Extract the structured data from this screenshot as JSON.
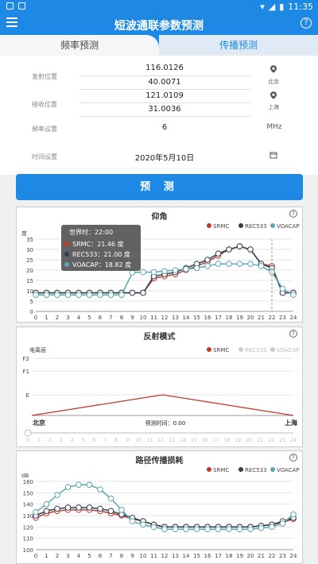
{
  "status": {
    "time": "11:35"
  },
  "app": {
    "title": "短波通联参数预测"
  },
  "tabs": [
    {
      "label": "频率预测"
    },
    {
      "label": "传播预测"
    }
  ],
  "form": {
    "tx": {
      "label": "发射位置",
      "lon": "116.0126",
      "lat": "40.0071",
      "city": "北京"
    },
    "rx": {
      "label": "接收位置",
      "lon": "121.0109",
      "lat": "31.0036",
      "city": "上海"
    },
    "freq": {
      "label": "频率设置",
      "value": "6",
      "unit": "MHz"
    },
    "date": {
      "label": "时间设置",
      "value": "2020年5月10日"
    }
  },
  "predict_button": {
    "label": "预 测"
  },
  "colors": {
    "srmc": "#c0392b",
    "rec533": "#2c3e50",
    "voacap": "#5aa7b0",
    "accent": "#1e88e5"
  },
  "legend": [
    "SRMC",
    "REC533",
    "VOACAP"
  ],
  "chart_data": [
    {
      "type": "line",
      "title": "仰角",
      "ylabel": "度",
      "ylim": [
        0,
        35
      ],
      "yticks": [
        0,
        5,
        10,
        15,
        20,
        25,
        30,
        35
      ],
      "x": [
        0,
        1,
        2,
        3,
        4,
        5,
        6,
        7,
        8,
        9,
        10,
        11,
        12,
        13,
        14,
        15,
        16,
        17,
        18,
        19,
        20,
        21,
        22,
        23,
        24
      ],
      "series": [
        {
          "name": "SRMC",
          "values": [
            9,
            9,
            9,
            9,
            9,
            9,
            9,
            9,
            9,
            9,
            9,
            16,
            17,
            18,
            20,
            22,
            24,
            27,
            30,
            31.5,
            30,
            23,
            22,
            9,
            9
          ]
        },
        {
          "name": "REC533",
          "values": [
            9,
            9,
            9,
            9,
            9,
            9,
            9,
            9,
            9,
            9,
            9,
            17,
            18,
            19,
            21,
            23,
            25,
            28,
            30,
            31.5,
            30,
            23,
            21,
            9,
            9
          ]
        },
        {
          "name": "VOACAP",
          "values": [
            8,
            8,
            8,
            8,
            8,
            8,
            8,
            8,
            8,
            18.8,
            19,
            19,
            19.5,
            20,
            20.5,
            21,
            22,
            23,
            23,
            23,
            23,
            22,
            19,
            11,
            8
          ]
        }
      ],
      "tooltip": {
        "title": "世界时：22:00",
        "items": [
          "SRMC：21.46 度",
          "REC533：21.00 度",
          "VOACAP：18.82 度"
        ]
      }
    },
    {
      "type": "line",
      "title": "反射模式",
      "ylabel": "电离层",
      "ycats": [
        "",
        "E",
        "F1",
        "F2"
      ],
      "x": [
        0,
        1,
        2,
        3,
        4,
        5,
        6,
        7,
        8,
        9,
        10,
        11,
        12,
        13,
        14,
        15,
        16,
        17,
        18,
        19,
        20,
        21,
        22,
        23,
        24
      ],
      "start_label": "北京",
      "end_label": "上海",
      "center_label": "预测时间：0:00"
    },
    {
      "type": "line",
      "title": "路径传播损耗",
      "ylabel": "dB",
      "ylim": [
        100,
        160
      ],
      "yticks": [
        100,
        110,
        120,
        130,
        140,
        150,
        160
      ],
      "x": [
        0,
        1,
        2,
        3,
        4,
        5,
        6,
        7,
        8,
        9,
        10,
        11,
        12,
        13,
        14,
        15,
        16,
        17,
        18,
        19,
        20,
        21,
        22,
        23,
        24
      ],
      "series": [
        {
          "name": "SRMC",
          "values": [
            128,
            132,
            134,
            135,
            135,
            135,
            134,
            132,
            130,
            127,
            125,
            122,
            120,
            120,
            120,
            120,
            120,
            120,
            120,
            120,
            120,
            121,
            122,
            124,
            127
          ]
        },
        {
          "name": "REC533",
          "values": [
            130,
            134,
            136,
            137,
            137,
            137,
            136,
            134,
            131,
            128,
            125,
            122,
            120,
            120,
            120,
            120,
            120,
            120,
            120,
            120,
            120,
            121,
            122,
            125,
            128
          ]
        },
        {
          "name": "VOACAP",
          "values": [
            133,
            140,
            148,
            155,
            157,
            157,
            153,
            145,
            135,
            125,
            122,
            120,
            118,
            118,
            118,
            118,
            118,
            118,
            118,
            118,
            118,
            119,
            120,
            123,
            131
          ]
        }
      ]
    }
  ]
}
